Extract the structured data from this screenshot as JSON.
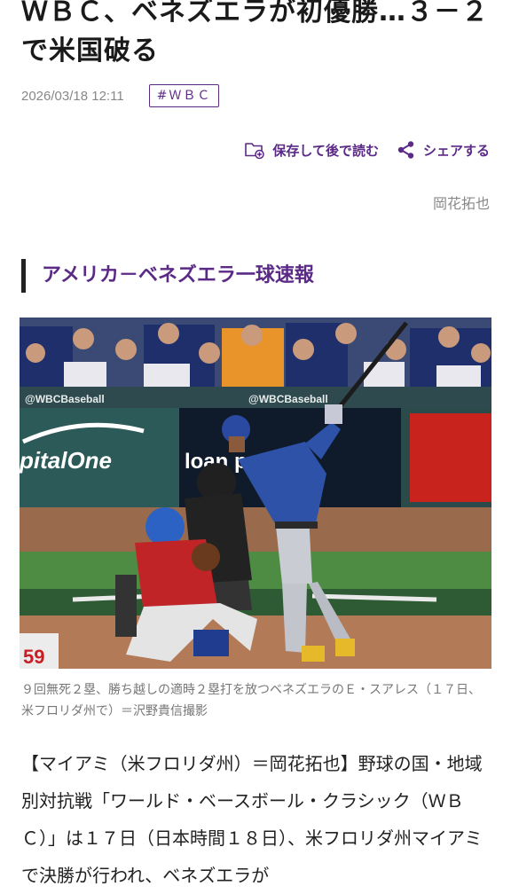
{
  "article": {
    "title": "ＷＢＣ、ベネズエラが初優勝…３－２で米国破る",
    "date": "2026/03/18 12:11",
    "tag": "#ＷＢＣ",
    "save_label": "保存して後で読む",
    "share_label": "シェアする",
    "byline": "岡花拓也",
    "section_heading": "アメリカ－ベネズエラ一球速報",
    "photo": {
      "caption": "９回無死２塁、勝ち越しの適時２塁打を放つベネズエラのＥ・スアレス（１７日、米フロリダ州で）＝沢野貴信撮影",
      "wall_text_left": "@WBCBaseball",
      "wall_text_right": "@WBCBaseball",
      "sponsor_left": "pitalOne",
      "sponsor_right": "loan  park",
      "uniform_number": "59"
    },
    "body": "【マイアミ（米フロリダ州）＝岡花拓也】野球の国・地域別対抗戦「ワールド・ベースボール・クラシック（ＷＢＣ）」は１７日（日本時間１８日）、米フロリダ州マイアミで決勝が行われ、ベネズエラが"
  },
  "colors": {
    "accent": "#5b2a86",
    "meta_gray": "#888888"
  },
  "icons": {
    "save": "folder-plus-icon",
    "share": "share-icon"
  }
}
